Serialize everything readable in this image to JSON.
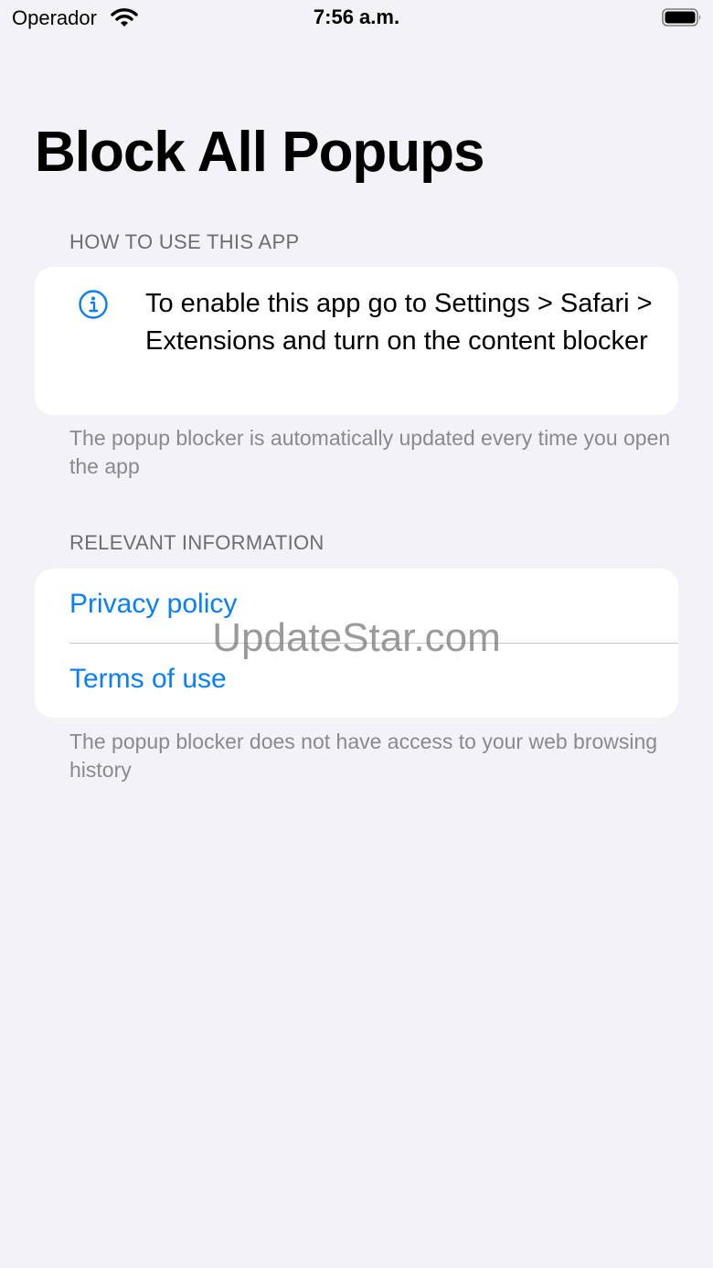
{
  "status_bar": {
    "carrier": "Operador",
    "time": "7:56 a.m.",
    "wifi_icon": "wifi-icon",
    "battery_icon": "battery-icon"
  },
  "page": {
    "title": "Block All Popups"
  },
  "how_to_section": {
    "header": "HOW TO USE THIS APP",
    "icon": "info-icon",
    "instruction": "To enable this app go to Settings > Safari > Extensions and turn on the content blocker",
    "footer": "The popup blocker is automatically updated every time you open the app"
  },
  "relevant_section": {
    "header": "RELEVANT INFORMATION",
    "links": [
      {
        "label": "Privacy policy"
      },
      {
        "label": "Terms of use"
      }
    ],
    "footer": "The popup blocker does not have access to your web browsing history"
  },
  "watermark": "UpdateStar.com",
  "colors": {
    "background": "#f2f2f7",
    "card": "#ffffff",
    "link": "#0a7ff5",
    "secondary_text": "#8a8a8e"
  }
}
